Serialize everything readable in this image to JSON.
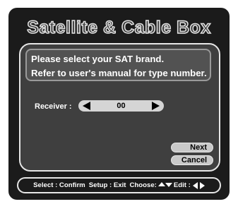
{
  "title": "Satellite & Cable Box",
  "message": {
    "line1": "Please select  your SAT brand.",
    "line2": "Refer to user's manual for type number."
  },
  "receiver": {
    "label": "Receiver :",
    "value": "00"
  },
  "buttons": {
    "next": "Next",
    "cancel": "Cancel"
  },
  "footer": {
    "select": "Select : Confirm",
    "setup": "Setup : Exit",
    "choose": "Choose:",
    "edit": "Edit :"
  },
  "icons": {
    "receiver_left": "triangle-left-icon",
    "receiver_right": "triangle-right-icon",
    "choose": "up-down-arrows-icon",
    "edit_left": "triangle-left-icon",
    "edit_right": "triangle-right-icon"
  },
  "colors": {
    "screen_background": "#1b1b1b",
    "panel_background": "#3f3f3f",
    "selector_background": "#d5d5d5",
    "button_background": "#c9c9c9"
  }
}
